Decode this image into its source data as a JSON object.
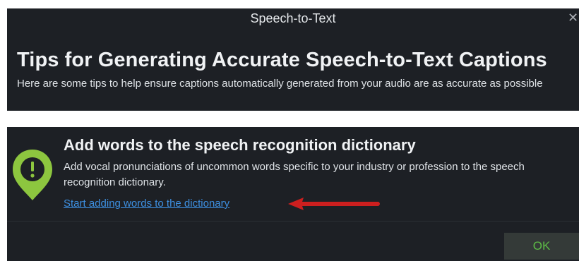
{
  "dialog": {
    "title": "Speech-to-Text",
    "close_icon": "close-icon",
    "close_glyph": "✕"
  },
  "tips": {
    "heading": "Tips for Generating Accurate Speech-to-Text Captions",
    "subtext": "Here are some tips to help ensure captions automatically generated from your audio are as accurate as possible"
  },
  "tip": {
    "icon": "exclamation-pin-icon",
    "heading": "Add words to the speech recognition dictionary",
    "body": "Add vocal pronunciations of uncommon words specific to your industry or profession to the speech recognition dictionary.",
    "link_label": "Start adding words to the dictionary"
  },
  "footer": {
    "ok_label": "OK"
  },
  "colors": {
    "panel_bg": "#1d2025",
    "accent_green": "#5dbb46",
    "badge_green": "#8dc63f",
    "link_blue": "#3d8fe0",
    "annotation_red": "#cc1f1f"
  }
}
